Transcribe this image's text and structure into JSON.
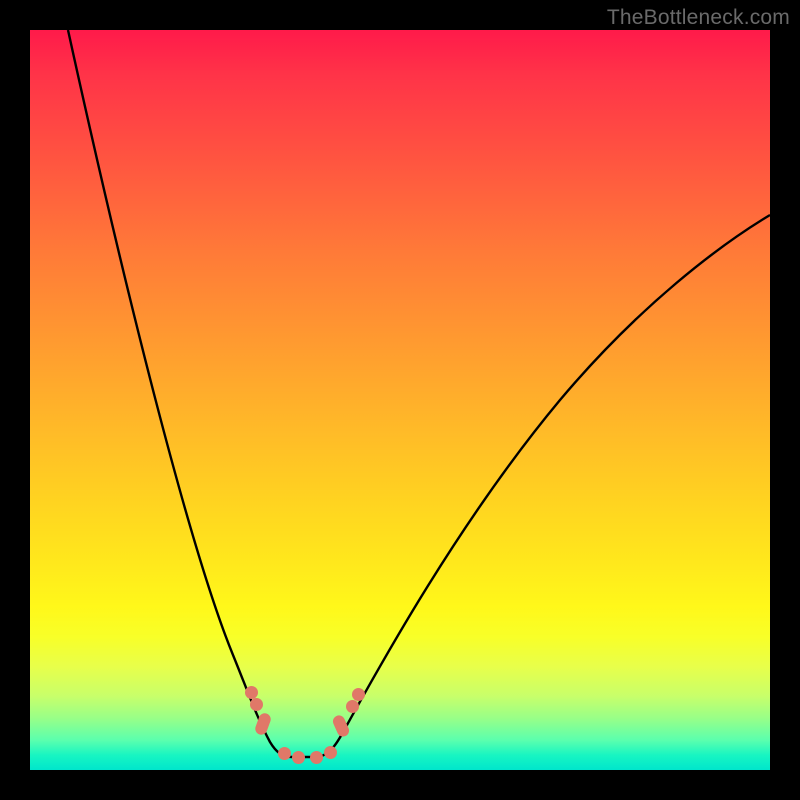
{
  "watermark": "TheBottleneck.com",
  "chart_data": {
    "type": "line",
    "title": "",
    "xlabel": "",
    "ylabel": "",
    "x": [
      0.0,
      0.05,
      0.1,
      0.15,
      0.2,
      0.25,
      0.28,
      0.3,
      0.33,
      0.36,
      0.4,
      0.45,
      0.5,
      0.6,
      0.7,
      0.8,
      0.9,
      1.0
    ],
    "y": [
      1.0,
      0.74,
      0.52,
      0.34,
      0.2,
      0.1,
      0.05,
      0.02,
      0.0,
      0.0,
      0.02,
      0.08,
      0.16,
      0.32,
      0.45,
      0.55,
      0.62,
      0.68
    ],
    "xlim": [
      0,
      1
    ],
    "ylim": [
      0,
      1
    ],
    "annotations": [
      {
        "kind": "cap",
        "at_x": 0.275
      },
      {
        "kind": "cap",
        "at_x": 0.395
      },
      {
        "kind": "bead",
        "at_x": 0.3
      },
      {
        "kind": "bead",
        "at_x": 0.325
      },
      {
        "kind": "bead",
        "at_x": 0.36
      },
      {
        "kind": "bead",
        "at_x": 0.375
      },
      {
        "kind": "bead_upper_left",
        "at_x": 0.265
      },
      {
        "kind": "bead_upper_left",
        "at_x": 0.275
      },
      {
        "kind": "bead_upper_right",
        "at_x": 0.405
      },
      {
        "kind": "bead_upper_right",
        "at_x": 0.415
      }
    ],
    "background_gradient": {
      "top": "#ff1a4a",
      "mid": "#ffe81c",
      "bottom": "#00e6cc"
    }
  }
}
